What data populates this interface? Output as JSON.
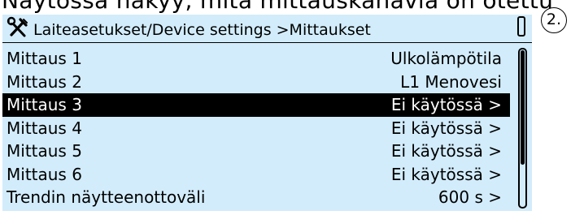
{
  "caption": "Näytössä näkyy, mitä mittauskanavia on otettu",
  "step_badge": "2.",
  "header": {
    "icon": "tools-icon",
    "title": "Laiteasetukset/Device settings >Mittaukset"
  },
  "rows": [
    {
      "label": "Mittaus 1",
      "value": "Ulkolämpötila"
    },
    {
      "label": "Mittaus 2",
      "value": "L1 Menovesi"
    },
    {
      "label": "Mittaus 3",
      "value": "Ei käytössä >"
    },
    {
      "label": "Mittaus 4",
      "value": "Ei käytössä >"
    },
    {
      "label": "Mittaus 5",
      "value": "Ei käytössä >"
    },
    {
      "label": "Mittaus 6",
      "value": "Ei käytössä >"
    },
    {
      "label": "Trendin näytteenottoväli",
      "value": "600 s >"
    }
  ],
  "selected_row": 2,
  "colors": {
    "screen_background": "#d2ecfb",
    "selected_background": "#000000",
    "selected_text": "#ffffff"
  }
}
